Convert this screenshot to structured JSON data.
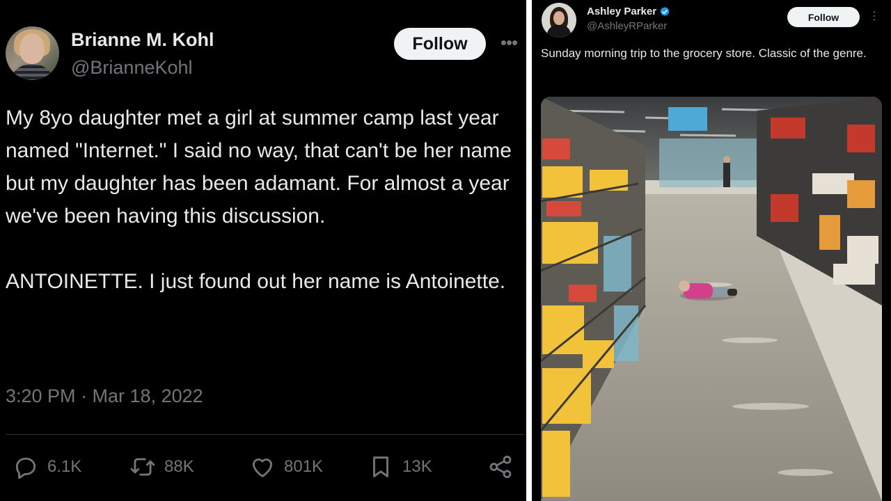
{
  "left_tweet": {
    "author_name": "Brianne M. Kohl",
    "author_handle": "@BrianneKohl",
    "follow_label": "Follow",
    "more_icon": "ellipsis-icon",
    "text": "My 8yo daughter met a girl at summer camp last year named \"Internet.\" I said no way, that can't be her name but my daughter has been adamant. For almost a year we've been having this discussion.\n\nANTOINETTE. I just found out her name is Antoinette.",
    "timestamp": "3:20 PM · Mar 18, 2022",
    "actions": {
      "replies": "6.1K",
      "reposts": "88K",
      "likes": "801K",
      "bookmarks": "13K"
    }
  },
  "right_tweet": {
    "author_name": "Ashley Parker",
    "author_handle": "@AshleyRParker",
    "verified_icon": "verified-badge-icon",
    "follow_label": "Follow",
    "more_icon": "vertical-ellipsis-icon",
    "text": "Sunday morning trip to the grocery store. Classic of the genre.",
    "photo_alt": "Grocery store aisle with a child lying on the floor"
  },
  "colors": {
    "background": "#000000",
    "text_primary": "#e7e9ea",
    "text_secondary": "#71767b",
    "follow_button": "#eff3f4",
    "verified": "#1d9bf0",
    "divider": "#2f3336"
  }
}
